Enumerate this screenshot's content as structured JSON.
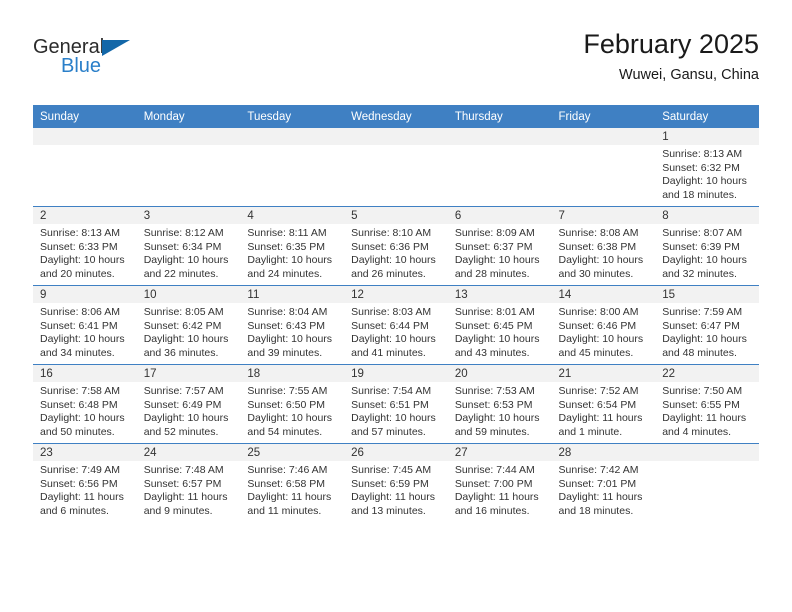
{
  "brand": {
    "word_one": "General",
    "word_two": "Blue",
    "triangle_color": "#1367a8",
    "blue_color": "#2a7fc9"
  },
  "header": {
    "title": "February 2025",
    "subtitle": "Wuwei, Gansu, China"
  },
  "theme": {
    "header_bg": "#3f80c3",
    "row_divider": "#3f80c3",
    "daynum_bg": "#f2f2f2",
    "text": "#333333"
  },
  "weekday_headers": [
    "Sunday",
    "Monday",
    "Tuesday",
    "Wednesday",
    "Thursday",
    "Friday",
    "Saturday"
  ],
  "weeks": [
    [
      {
        "day": "",
        "sunrise": "",
        "sunset": "",
        "daylight1": "",
        "daylight2": ""
      },
      {
        "day": "",
        "sunrise": "",
        "sunset": "",
        "daylight1": "",
        "daylight2": ""
      },
      {
        "day": "",
        "sunrise": "",
        "sunset": "",
        "daylight1": "",
        "daylight2": ""
      },
      {
        "day": "",
        "sunrise": "",
        "sunset": "",
        "daylight1": "",
        "daylight2": ""
      },
      {
        "day": "",
        "sunrise": "",
        "sunset": "",
        "daylight1": "",
        "daylight2": ""
      },
      {
        "day": "",
        "sunrise": "",
        "sunset": "",
        "daylight1": "",
        "daylight2": ""
      },
      {
        "day": "1",
        "sunrise": "Sunrise: 8:13 AM",
        "sunset": "Sunset: 6:32 PM",
        "daylight1": "Daylight: 10 hours",
        "daylight2": "and 18 minutes."
      }
    ],
    [
      {
        "day": "2",
        "sunrise": "Sunrise: 8:13 AM",
        "sunset": "Sunset: 6:33 PM",
        "daylight1": "Daylight: 10 hours",
        "daylight2": "and 20 minutes."
      },
      {
        "day": "3",
        "sunrise": "Sunrise: 8:12 AM",
        "sunset": "Sunset: 6:34 PM",
        "daylight1": "Daylight: 10 hours",
        "daylight2": "and 22 minutes."
      },
      {
        "day": "4",
        "sunrise": "Sunrise: 8:11 AM",
        "sunset": "Sunset: 6:35 PM",
        "daylight1": "Daylight: 10 hours",
        "daylight2": "and 24 minutes."
      },
      {
        "day": "5",
        "sunrise": "Sunrise: 8:10 AM",
        "sunset": "Sunset: 6:36 PM",
        "daylight1": "Daylight: 10 hours",
        "daylight2": "and 26 minutes."
      },
      {
        "day": "6",
        "sunrise": "Sunrise: 8:09 AM",
        "sunset": "Sunset: 6:37 PM",
        "daylight1": "Daylight: 10 hours",
        "daylight2": "and 28 minutes."
      },
      {
        "day": "7",
        "sunrise": "Sunrise: 8:08 AM",
        "sunset": "Sunset: 6:38 PM",
        "daylight1": "Daylight: 10 hours",
        "daylight2": "and 30 minutes."
      },
      {
        "day": "8",
        "sunrise": "Sunrise: 8:07 AM",
        "sunset": "Sunset: 6:39 PM",
        "daylight1": "Daylight: 10 hours",
        "daylight2": "and 32 minutes."
      }
    ],
    [
      {
        "day": "9",
        "sunrise": "Sunrise: 8:06 AM",
        "sunset": "Sunset: 6:41 PM",
        "daylight1": "Daylight: 10 hours",
        "daylight2": "and 34 minutes."
      },
      {
        "day": "10",
        "sunrise": "Sunrise: 8:05 AM",
        "sunset": "Sunset: 6:42 PM",
        "daylight1": "Daylight: 10 hours",
        "daylight2": "and 36 minutes."
      },
      {
        "day": "11",
        "sunrise": "Sunrise: 8:04 AM",
        "sunset": "Sunset: 6:43 PM",
        "daylight1": "Daylight: 10 hours",
        "daylight2": "and 39 minutes."
      },
      {
        "day": "12",
        "sunrise": "Sunrise: 8:03 AM",
        "sunset": "Sunset: 6:44 PM",
        "daylight1": "Daylight: 10 hours",
        "daylight2": "and 41 minutes."
      },
      {
        "day": "13",
        "sunrise": "Sunrise: 8:01 AM",
        "sunset": "Sunset: 6:45 PM",
        "daylight1": "Daylight: 10 hours",
        "daylight2": "and 43 minutes."
      },
      {
        "day": "14",
        "sunrise": "Sunrise: 8:00 AM",
        "sunset": "Sunset: 6:46 PM",
        "daylight1": "Daylight: 10 hours",
        "daylight2": "and 45 minutes."
      },
      {
        "day": "15",
        "sunrise": "Sunrise: 7:59 AM",
        "sunset": "Sunset: 6:47 PM",
        "daylight1": "Daylight: 10 hours",
        "daylight2": "and 48 minutes."
      }
    ],
    [
      {
        "day": "16",
        "sunrise": "Sunrise: 7:58 AM",
        "sunset": "Sunset: 6:48 PM",
        "daylight1": "Daylight: 10 hours",
        "daylight2": "and 50 minutes."
      },
      {
        "day": "17",
        "sunrise": "Sunrise: 7:57 AM",
        "sunset": "Sunset: 6:49 PM",
        "daylight1": "Daylight: 10 hours",
        "daylight2": "and 52 minutes."
      },
      {
        "day": "18",
        "sunrise": "Sunrise: 7:55 AM",
        "sunset": "Sunset: 6:50 PM",
        "daylight1": "Daylight: 10 hours",
        "daylight2": "and 54 minutes."
      },
      {
        "day": "19",
        "sunrise": "Sunrise: 7:54 AM",
        "sunset": "Sunset: 6:51 PM",
        "daylight1": "Daylight: 10 hours",
        "daylight2": "and 57 minutes."
      },
      {
        "day": "20",
        "sunrise": "Sunrise: 7:53 AM",
        "sunset": "Sunset: 6:53 PM",
        "daylight1": "Daylight: 10 hours",
        "daylight2": "and 59 minutes."
      },
      {
        "day": "21",
        "sunrise": "Sunrise: 7:52 AM",
        "sunset": "Sunset: 6:54 PM",
        "daylight1": "Daylight: 11 hours",
        "daylight2": "and 1 minute."
      },
      {
        "day": "22",
        "sunrise": "Sunrise: 7:50 AM",
        "sunset": "Sunset: 6:55 PM",
        "daylight1": "Daylight: 11 hours",
        "daylight2": "and 4 minutes."
      }
    ],
    [
      {
        "day": "23",
        "sunrise": "Sunrise: 7:49 AM",
        "sunset": "Sunset: 6:56 PM",
        "daylight1": "Daylight: 11 hours",
        "daylight2": "and 6 minutes."
      },
      {
        "day": "24",
        "sunrise": "Sunrise: 7:48 AM",
        "sunset": "Sunset: 6:57 PM",
        "daylight1": "Daylight: 11 hours",
        "daylight2": "and 9 minutes."
      },
      {
        "day": "25",
        "sunrise": "Sunrise: 7:46 AM",
        "sunset": "Sunset: 6:58 PM",
        "daylight1": "Daylight: 11 hours",
        "daylight2": "and 11 minutes."
      },
      {
        "day": "26",
        "sunrise": "Sunrise: 7:45 AM",
        "sunset": "Sunset: 6:59 PM",
        "daylight1": "Daylight: 11 hours",
        "daylight2": "and 13 minutes."
      },
      {
        "day": "27",
        "sunrise": "Sunrise: 7:44 AM",
        "sunset": "Sunset: 7:00 PM",
        "daylight1": "Daylight: 11 hours",
        "daylight2": "and 16 minutes."
      },
      {
        "day": "28",
        "sunrise": "Sunrise: 7:42 AM",
        "sunset": "Sunset: 7:01 PM",
        "daylight1": "Daylight: 11 hours",
        "daylight2": "and 18 minutes."
      },
      {
        "day": "",
        "sunrise": "",
        "sunset": "",
        "daylight1": "",
        "daylight2": ""
      }
    ]
  ]
}
